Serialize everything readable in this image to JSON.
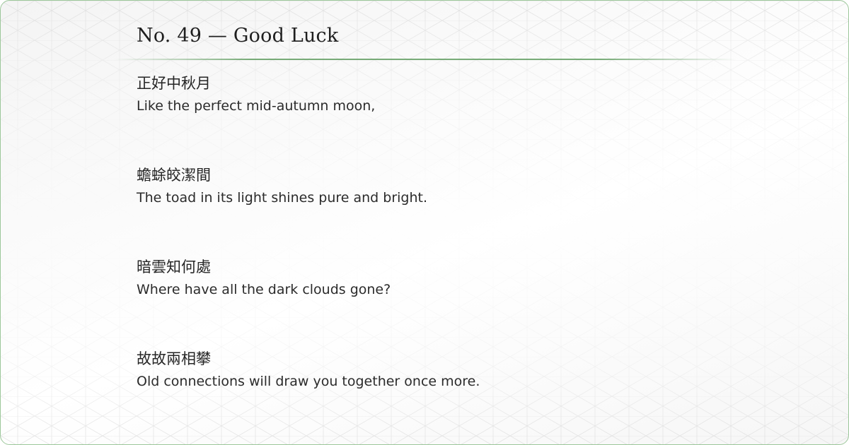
{
  "card": {
    "title": "No. 49 — Good Luck",
    "accent_color": "#4c914c",
    "border_color": "#9cc79a"
  },
  "verses": [
    {
      "chinese": "正好中秋月",
      "english": "Like the perfect mid-autumn moon,"
    },
    {
      "chinese": "蟾蜍皎潔間",
      "english": "The toad in its light shines pure and bright."
    },
    {
      "chinese": "暗雲知何處",
      "english": "Where have all the dark clouds gone?"
    },
    {
      "chinese": "故故兩相攀",
      "english": "Old connections will draw you together once more."
    }
  ]
}
